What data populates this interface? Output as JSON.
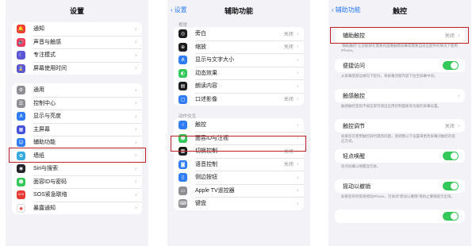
{
  "panel1": {
    "title": "设置",
    "group1": [
      {
        "label": "通知",
        "icon": "bell-icon",
        "color": "#f23b35",
        "glyph": "🔔"
      },
      {
        "label": "声音与触感",
        "icon": "speaker-icon",
        "color": "#f2395c",
        "glyph": "🔊"
      },
      {
        "label": "专注模式",
        "icon": "moon-icon",
        "color": "#5b56d6",
        "glyph": "☾"
      },
      {
        "label": "屏幕使用时间",
        "icon": "hourglass-icon",
        "color": "#5b56d6",
        "glyph": "⌛"
      }
    ],
    "group2": [
      {
        "label": "通用",
        "icon": "gear-icon",
        "color": "#8e8e93",
        "glyph": "⚙"
      },
      {
        "label": "控制中心",
        "icon": "switches-icon",
        "color": "#8e8e93",
        "glyph": "☰"
      },
      {
        "label": "显示与亮度",
        "icon": "text-size-icon",
        "color": "#2f7cf6",
        "glyph": "A"
      },
      {
        "label": "主屏幕",
        "icon": "home-grid-icon",
        "color": "#4550d8",
        "glyph": "▦"
      },
      {
        "label": "辅助功能",
        "icon": "accessibility-icon",
        "color": "#2f7cf6",
        "glyph": "☺"
      },
      {
        "label": "墙纸",
        "icon": "wallpaper-icon",
        "color": "#35aadc",
        "glyph": "✿"
      },
      {
        "label": "Siri与搜索",
        "icon": "siri-icon",
        "color": "#222228",
        "glyph": "◉"
      },
      {
        "label": "面容ID与密码",
        "icon": "face-id-icon",
        "color": "#34c759",
        "glyph": "☻"
      },
      {
        "label": "SOS紧急联络",
        "icon": "sos-icon",
        "color": "#e53935",
        "glyph": "SOS"
      },
      {
        "label": "暴露通知",
        "icon": "exposure-icon",
        "color": "#ffffff",
        "glyph": "✺"
      }
    ]
  },
  "panel2": {
    "back": "设置",
    "title": "辅助功能",
    "section1_header": "视觉",
    "section1": [
      {
        "label": "旁白",
        "value": "关闭",
        "icon": "voiceover-icon",
        "color": "#1c1c1e",
        "glyph": "◎"
      },
      {
        "label": "缩放",
        "value": "关闭",
        "icon": "zoom-icon",
        "color": "#1c1c1e",
        "glyph": "⊕"
      },
      {
        "label": "显示与文字大小",
        "value": "",
        "icon": "text-size-icon",
        "color": "#2f7cf6",
        "glyph": "A"
      },
      {
        "label": "动态效果",
        "value": "",
        "icon": "motion-icon",
        "color": "#34c759",
        "glyph": "◐"
      },
      {
        "label": "朗读内容",
        "value": "",
        "icon": "speech-icon",
        "color": "#1c1c1e",
        "glyph": "▤"
      },
      {
        "label": "口述影像",
        "value": "关闭",
        "icon": "audio-description-icon",
        "color": "#2f7cf6",
        "glyph": "▢"
      }
    ],
    "section2_header": "动作交互",
    "section2": [
      {
        "label": "触控",
        "value": "",
        "icon": "touch-icon",
        "color": "#2f7cf6",
        "glyph": "☝"
      },
      {
        "label": "面容ID与注视",
        "value": "",
        "icon": "face-id-icon",
        "color": "#34c759",
        "glyph": "☻"
      },
      {
        "label": "切换控制",
        "value": "关闭",
        "icon": "switch-control-icon",
        "color": "#1c1c1e",
        "glyph": "▦"
      },
      {
        "label": "语音控制",
        "value": "关闭",
        "icon": "voice-control-icon",
        "color": "#2f7cf6",
        "glyph": "◙"
      },
      {
        "label": "侧边按钮",
        "value": "",
        "icon": "side-button-icon",
        "color": "#2f7cf6",
        "glyph": "▯"
      },
      {
        "label": "Apple TV遥控器",
        "value": "",
        "icon": "remote-icon",
        "color": "#8e8e93",
        "glyph": "▭"
      },
      {
        "label": "键盘",
        "value": "",
        "icon": "keyboard-icon",
        "color": "#8e8e93",
        "glyph": "⌨"
      }
    ]
  },
  "panel3": {
    "back": "辅助功能",
    "title": "触控",
    "items": [
      {
        "label": "辅助触控",
        "value": "关闭",
        "type": "chevron",
        "desc": "“辅助触控”让您能够在需要有困难触摸屏幕或需要自适应配件的情况下使用iPhone。"
      },
      {
        "label": "便捷访问",
        "value": "",
        "type": "toggle",
        "desc": "从屏幕底部边缘向下轻扫，将屏幕顶部内容下拉至屏幕中间。"
      },
      {
        "label": "触感触控",
        "value": "",
        "type": "chevron",
        "desc": "触感触控是指不按压即可调出应用控制面板等功能的屏幕设置。"
      },
      {
        "label": "触控调节",
        "value": "关闭",
        "type": "chevron",
        "desc": "如果您在使用触控屏时遇到问题，请调整以下设置来更改屏幕对触控的反应方式。"
      },
      {
        "label": "轻点唤醒",
        "value": "",
        "type": "toggle",
        "desc": "轻点屏幕以唤醒显示屏。"
      },
      {
        "label": "摇动以撤销",
        "value": "",
        "type": "toggle",
        "desc": "如果您有时容易摇动iPhone，可关闭“摇动以撤销”来防止撤销提示出现。"
      },
      {
        "label": "",
        "value": "",
        "type": "toggle",
        "desc": ""
      }
    ]
  },
  "colors": {
    "accent": "#2f7cf6",
    "highlight": "#c0202a",
    "toggle_on": "#34c759"
  }
}
